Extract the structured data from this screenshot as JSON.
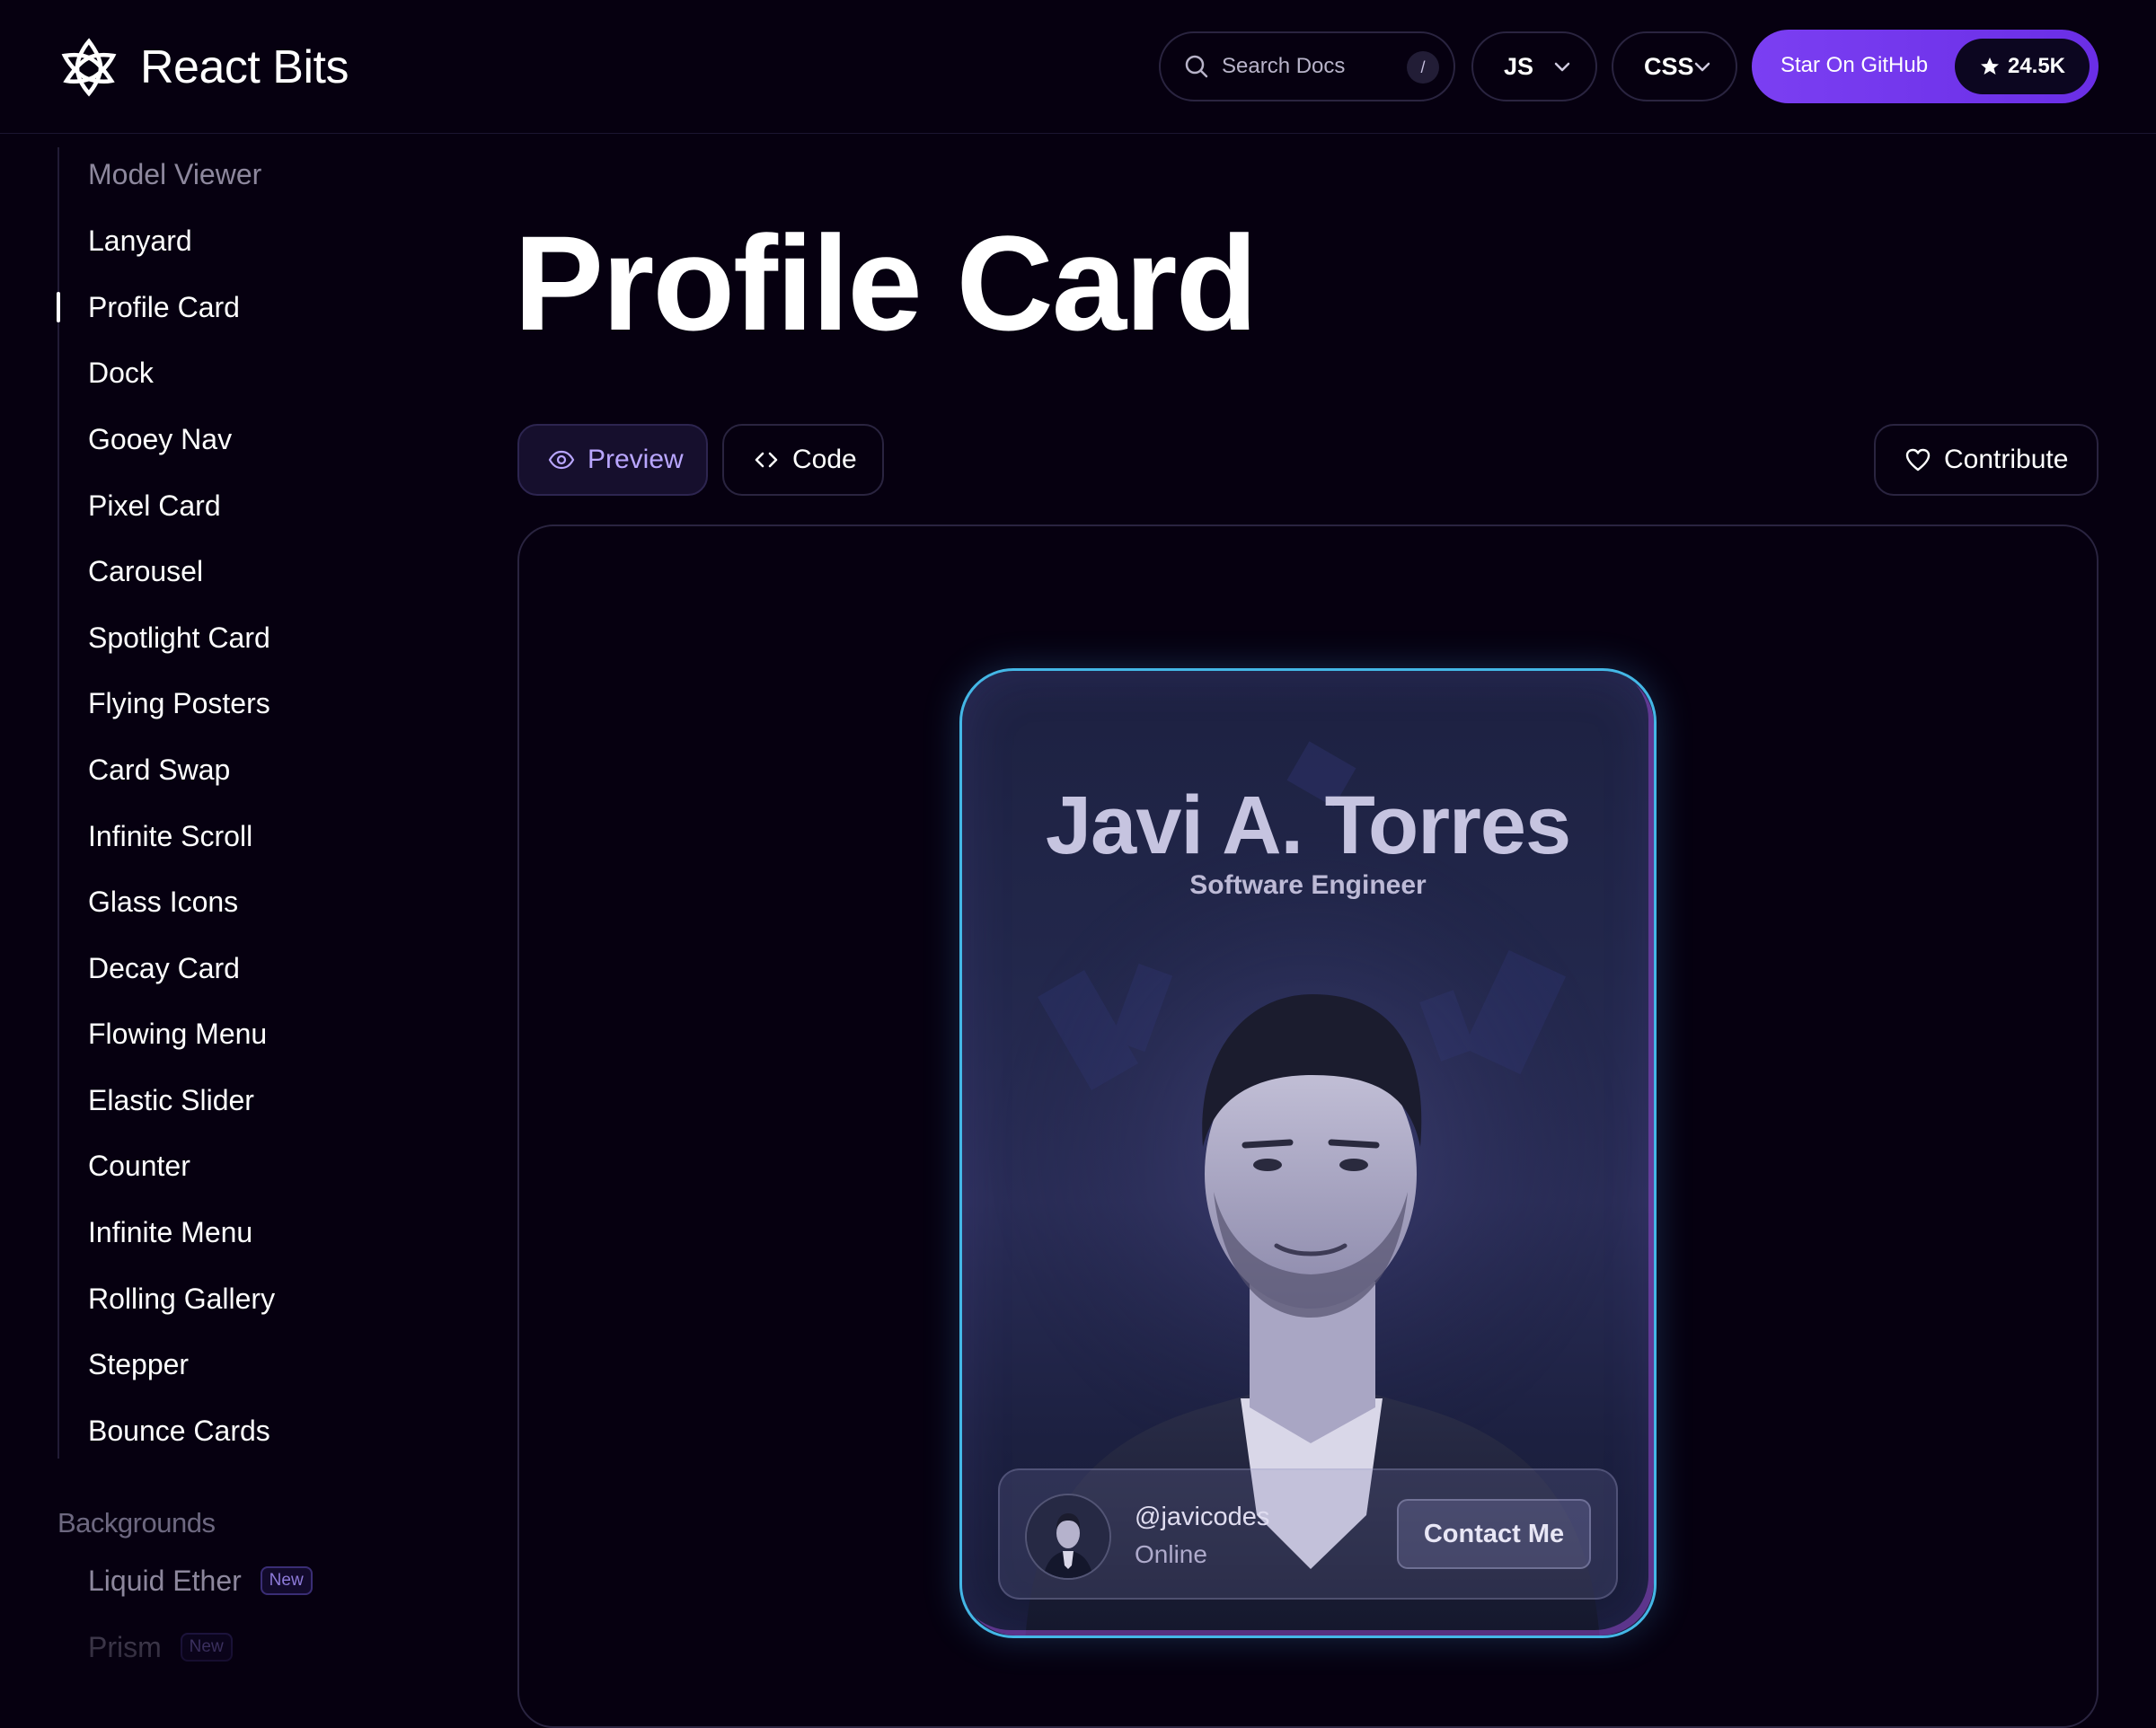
{
  "header": {
    "brand": "React Bits",
    "search_placeholder": "Search Docs",
    "search_shortcut": "/",
    "lang_select": "JS",
    "style_select": "CSS",
    "github_label": "Star On GitHub",
    "github_stars": "24.5K",
    "accent_color": "#7b3ff2"
  },
  "sidebar": {
    "items": [
      "Model Viewer",
      "Lanyard",
      "Profile Card",
      "Dock",
      "Gooey Nav",
      "Pixel Card",
      "Carousel",
      "Spotlight Card",
      "Flying Posters",
      "Card Swap",
      "Infinite Scroll",
      "Glass Icons",
      "Decay Card",
      "Flowing Menu",
      "Elastic Slider",
      "Counter",
      "Infinite Menu",
      "Rolling Gallery",
      "Stepper",
      "Bounce Cards"
    ],
    "active_item": "Profile Card",
    "section_title": "Backgrounds",
    "section_items": [
      "Liquid Ether",
      "Prism"
    ],
    "new_badge": "New"
  },
  "main": {
    "title": "Profile Card",
    "tabs": {
      "preview": "Preview",
      "code": "Code",
      "contribute": "Contribute"
    }
  },
  "profile": {
    "name": "Javi A. Torres",
    "role": "Software Engineer",
    "handle": "@javicodes",
    "status": "Online",
    "contact_label": "Contact Me"
  }
}
